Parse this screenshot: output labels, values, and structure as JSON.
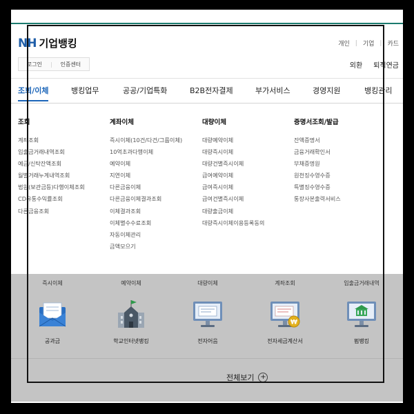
{
  "header": {
    "logo_nh": "NH",
    "logo_name": "기업뱅킹",
    "util_nav": [
      "개인",
      "기업",
      "카드"
    ],
    "login": "로그인",
    "cert": "인증센터",
    "right_links": [
      "외환",
      "퇴직연금"
    ]
  },
  "nav": {
    "tabs": [
      "조회/이체",
      "뱅킹업무",
      "공공/기업특화",
      "B2B전자결제",
      "부가서비스",
      "경영지원",
      "뱅킹관리"
    ],
    "active_index": 0
  },
  "menu": {
    "columns": [
      {
        "title": "조회",
        "items": [
          "계좌조회",
          "입출금거래내역조회",
          "예금/신탁잔액조회",
          "월별거래누계내역조회",
          "법원(보관금등)다행이체조회",
          "CD유통수익률조회",
          "다른금융조회"
        ]
      },
      {
        "title": "계좌이체",
        "items": [
          "즉시이체(10건/다건/그룹이체)",
          "10억초과다행이체",
          "예약이체",
          "지연이체",
          "다른금융이체",
          "다른금융이체결과조회",
          "이체결과조회",
          "이체별수수료조회",
          "자동이체관리",
          "금액모으기"
        ]
      },
      {
        "title": "대량이체",
        "items": [
          "대량예약이체",
          "대량즉시이체",
          "대량건별즉시이체",
          "급여예약이체",
          "급여즉시이체",
          "급여건별즉시이체",
          "대량출금이체",
          "대량즉시이체이용등록동의"
        ]
      },
      {
        "title": "증명서조회/발급",
        "items": [
          "잔액증명서",
          "금융거래확인서",
          "부채증명원",
          "원천징수영수증",
          "특별징수영수증",
          "통장사본출력서비스"
        ]
      }
    ]
  },
  "quick_menu": {
    "heads": [
      "즉시이체",
      "예약이체",
      "대량이체",
      "계좌조회",
      "입출금거래내역"
    ],
    "items": [
      {
        "label": "공과금",
        "icon": "envelope-icon"
      },
      {
        "label": "학교인터넷뱅킹",
        "icon": "school-icon"
      },
      {
        "label": "전자어음",
        "icon": "monitor-document-icon"
      },
      {
        "label": "전자세금계산서",
        "icon": "monitor-won-icon"
      },
      {
        "label": "펌뱅킹",
        "icon": "monitor-bank-icon"
      }
    ],
    "view_all": "전체보기"
  },
  "colors": {
    "brand_blue": "#1f5ea8",
    "active_tab": "#1a64b8",
    "top_line": "#1a7a6e",
    "quick_bg": "#c4c4c4"
  }
}
